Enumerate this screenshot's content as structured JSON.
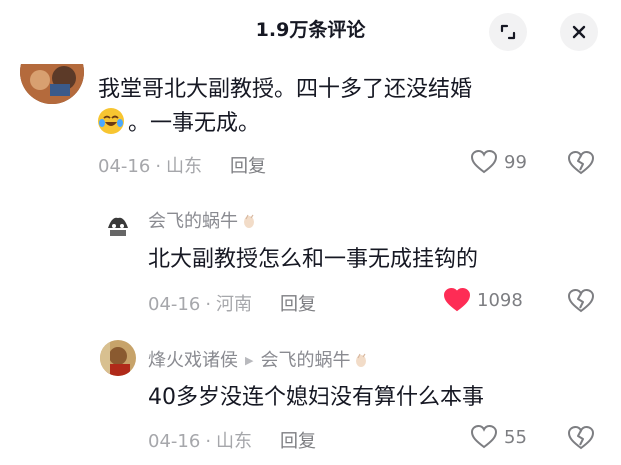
{
  "header": {
    "title": "1.9万条评论"
  },
  "comments": [
    {
      "text_line1": "我堂哥北大副教授。四十多了还没结婚",
      "text_line2": "。一事无成。",
      "emoji": "crying-laughing-emoji",
      "date": "04-16",
      "location": "山东",
      "reply_label": "回复",
      "likes": "99",
      "liked": false
    },
    {
      "username": "会飞的蜗牛",
      "text": "北大副教授怎么和一事无成挂钩的",
      "date": "04-16",
      "location": "河南",
      "reply_label": "回复",
      "likes": "1098",
      "liked": true
    },
    {
      "username": "烽火戏诸侯",
      "reply_to": "会飞的蜗牛",
      "text": "40多岁没连个媳妇没有算什么本事",
      "date": "04-16",
      "location": "山东",
      "reply_label": "回复",
      "likes": "55",
      "liked": false
    }
  ],
  "colors": {
    "liked_heart": "#fe2c55",
    "meta": "#a6a7ab"
  }
}
